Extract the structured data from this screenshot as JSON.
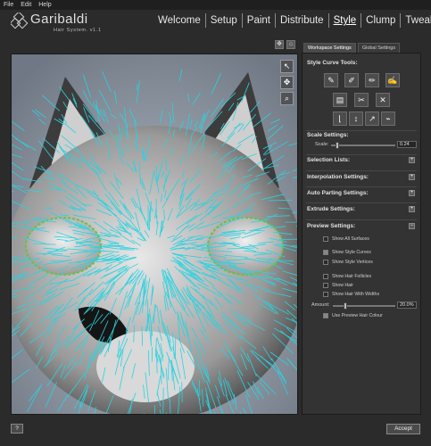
{
  "menu": [
    "File",
    "Edit",
    "Help"
  ],
  "logo": {
    "title": "Garibaldi",
    "subtitle": "Hair System.  v1.1"
  },
  "tabs": [
    "Welcome",
    "Setup",
    "Paint",
    "Distribute",
    "Style",
    "Clump",
    "Tweak"
  ],
  "active_tab": "Style",
  "viewport": {
    "header_icons": [
      "target-icon",
      "home-icon"
    ],
    "tools": [
      "select-arrow-icon",
      "move-cross-icon",
      "zoom-magnifier-icon"
    ]
  },
  "panel_tabs": [
    "Workspace Settings",
    "Global Settings"
  ],
  "style_curve_tools": {
    "title": "Style Curve Tools:",
    "icons": [
      "comb-tool-icon",
      "comb-smooth-icon",
      "comb-clump-icon",
      "comb-cut-icon",
      "ruler-icon",
      "scissors-icon",
      "tools-icon",
      "axis-icon",
      "length-arrows-icon",
      "curl-arrow-icon",
      "brush-tool-icon"
    ]
  },
  "scale_settings": {
    "title": "Scale Settings:",
    "label": "Scale:",
    "value": "0.24",
    "fraction": 0.1
  },
  "collapsed_sections": [
    "Selection Lists:",
    "Interpolation Settings:",
    "Auto Parting Settings:",
    "Extrude Settings:"
  ],
  "preview_settings": {
    "title": "Preview Settings:",
    "group1": [
      {
        "label": "Show All Surfaces",
        "checked": false
      }
    ],
    "group2": [
      {
        "label": "Show Style Curves",
        "checked": true
      },
      {
        "label": "Show Style Vertices",
        "checked": false
      }
    ],
    "group3": [
      {
        "label": "Show Hair Follicles",
        "checked": false
      },
      {
        "label": "Show Hair",
        "checked": false
      },
      {
        "label": "Show Hair With Widths",
        "checked": false
      }
    ],
    "amount_label": "Amount:",
    "amount_value": "20.0%",
    "amount_fraction": 0.2,
    "preview_colour": {
      "label": "Use Preview Hair Colour",
      "checked": true
    }
  },
  "footer": {
    "help": "?",
    "accept": "Accept"
  },
  "colors": {
    "hair": "#29d3e0",
    "background": "#2b2b2b",
    "panel": "#333333"
  }
}
